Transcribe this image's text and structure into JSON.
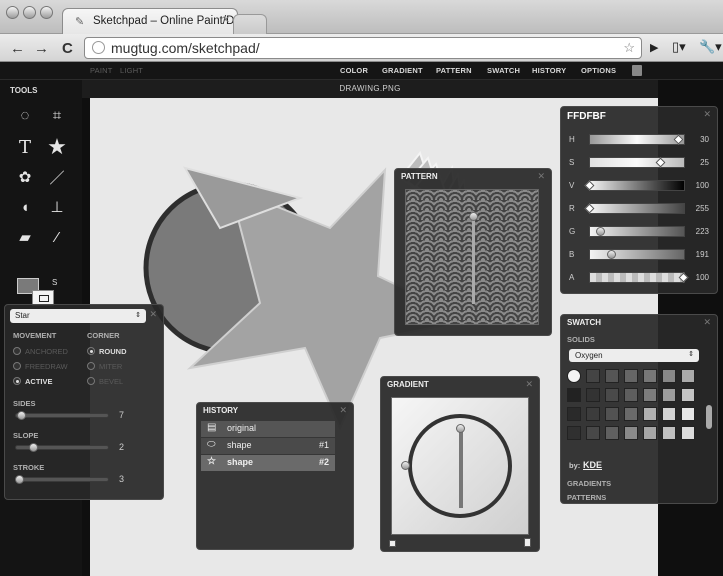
{
  "browser": {
    "tab_title": "Sketchpad – Online Paint/Dr...",
    "url": "mugtug.com/sketchpad/",
    "back_icon": "arrow-left-icon",
    "forward_icon": "arrow-right-icon",
    "reload_icon": "reload-icon"
  },
  "app": {
    "menu_left": [
      "PAINT",
      "LIGHT"
    ],
    "menu_right": [
      "COLOR",
      "GRADIENT",
      "PATTERN",
      "SWATCH",
      "HISTORY",
      "OPTIONS"
    ],
    "document_title": "DRAWING.PNG"
  },
  "tools": {
    "title": "TOOLS",
    "items": [
      "lasso-icon",
      "crop-icon",
      "text-icon",
      "star-icon",
      "flower-icon",
      "pencil-icon",
      "fill-icon",
      "stamp-icon",
      "eraser-icon",
      "picker-icon"
    ],
    "swap_label": "S"
  },
  "shape_panel": {
    "select_value": "Star",
    "movement_label": "MOVEMENT",
    "corner_label": "CORNER",
    "movement_options": [
      "ANCHORED",
      "FREEDRAW",
      "ACTIVE"
    ],
    "movement_selected": "ACTIVE",
    "corner_options": [
      "ROUND",
      "MITER",
      "BEVEL"
    ],
    "corner_selected": "ROUND",
    "sliders": [
      {
        "label": "SIDES",
        "value": "7"
      },
      {
        "label": "SLOPE",
        "value": "2"
      },
      {
        "label": "STROKE",
        "value": "3"
      }
    ]
  },
  "color_panel": {
    "hex": "FFDFBF",
    "channels": [
      {
        "label": "H",
        "value": "30"
      },
      {
        "label": "S",
        "value": "25"
      },
      {
        "label": "V",
        "value": "100"
      },
      {
        "label": "R",
        "value": "255"
      },
      {
        "label": "G",
        "value": "223"
      },
      {
        "label": "B",
        "value": "191"
      },
      {
        "label": "A",
        "value": "100"
      }
    ]
  },
  "pattern_panel": {
    "title": "PATTERN"
  },
  "gradient_panel": {
    "title": "GRADIENT"
  },
  "history_panel": {
    "title": "HISTORY",
    "rows": [
      {
        "label": "original",
        "num": ""
      },
      {
        "label": "shape",
        "num": "#1"
      },
      {
        "label": "shape",
        "num": "#2"
      }
    ]
  },
  "swatch_panel": {
    "title": "SWATCH",
    "solids_label": "SOLIDS",
    "palette_value": "Oxygen",
    "credit_prefix": "by:",
    "credit_link": "KDE",
    "gradients_label": "GRADIENTS",
    "patterns_label": "PATTERNS"
  }
}
